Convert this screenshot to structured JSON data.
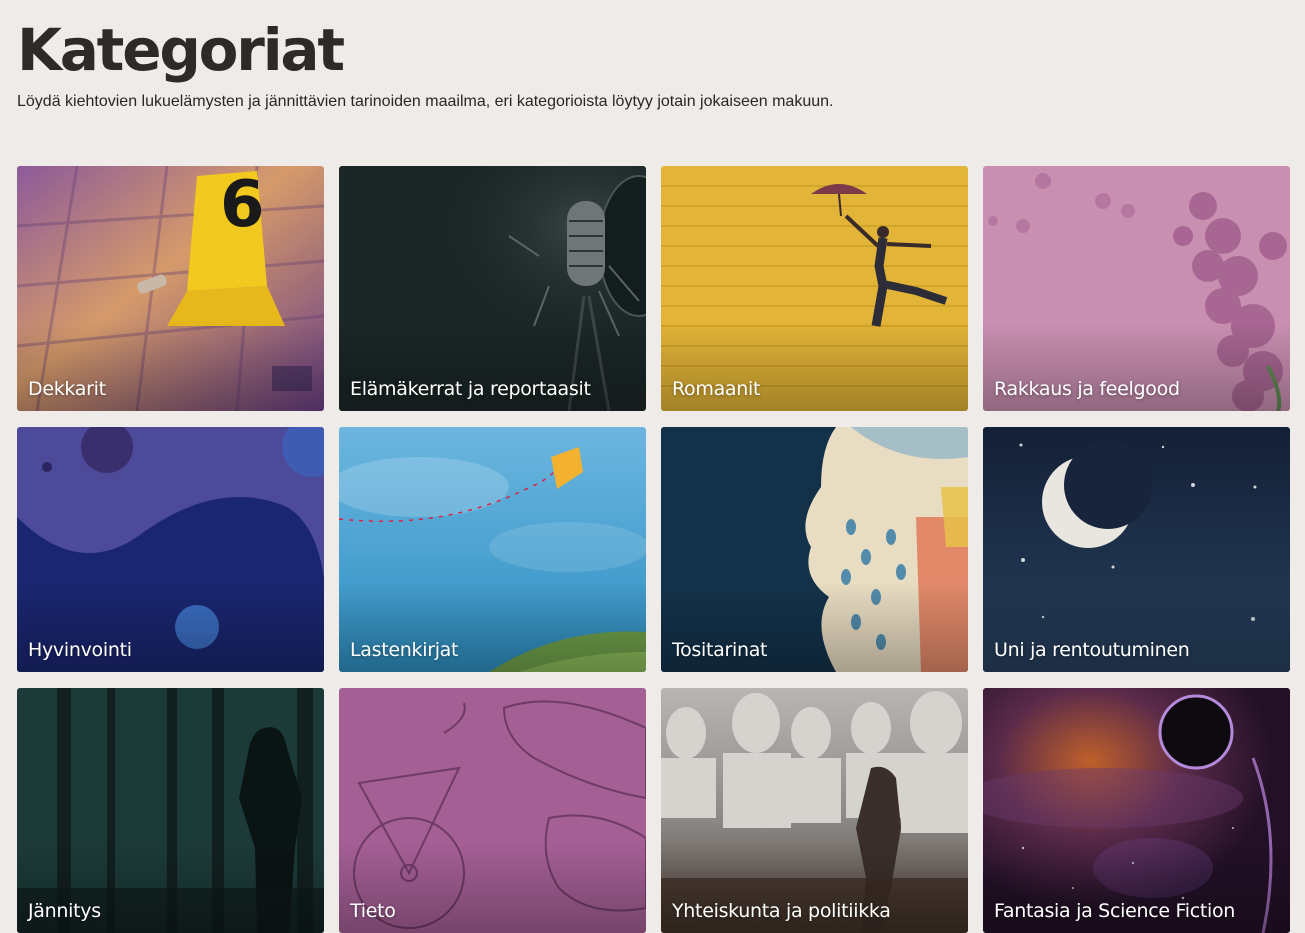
{
  "page": {
    "title": "Kategoriat",
    "subtitle": "Löydä kiehtovien lukuelämysten ja jännittävien tarinoiden maailma, eri kategorioista löytyy jotain jokaiseen makuun."
  },
  "categories": [
    {
      "label": "Dekkarit",
      "color": "#7a4a8a"
    },
    {
      "label": "Elämäkerrat ja reportaasit",
      "color": "#1b2626"
    },
    {
      "label": "Romaanit",
      "color": "#e2b437"
    },
    {
      "label": "Rakkaus ja feelgood",
      "color": "#c98fb1"
    },
    {
      "label": "Hyvinvointi",
      "color": "#1f2e7a"
    },
    {
      "label": "Lastenkirjat",
      "color": "#4fa3d4"
    },
    {
      "label": "Tositarinat",
      "color": "#13324a"
    },
    {
      "label": "Uni ja rentoutuminen",
      "color": "#16233c"
    },
    {
      "label": "Jännitys",
      "color": "#17302e"
    },
    {
      "label": "Tieto",
      "color": "#a45f95"
    },
    {
      "label": "Yhteiskunta ja politiikka",
      "color": "#7d7a78"
    },
    {
      "label": "Fantasia ja Science Fiction",
      "color": "#2a1530"
    }
  ],
  "crime_card_marker": "6"
}
